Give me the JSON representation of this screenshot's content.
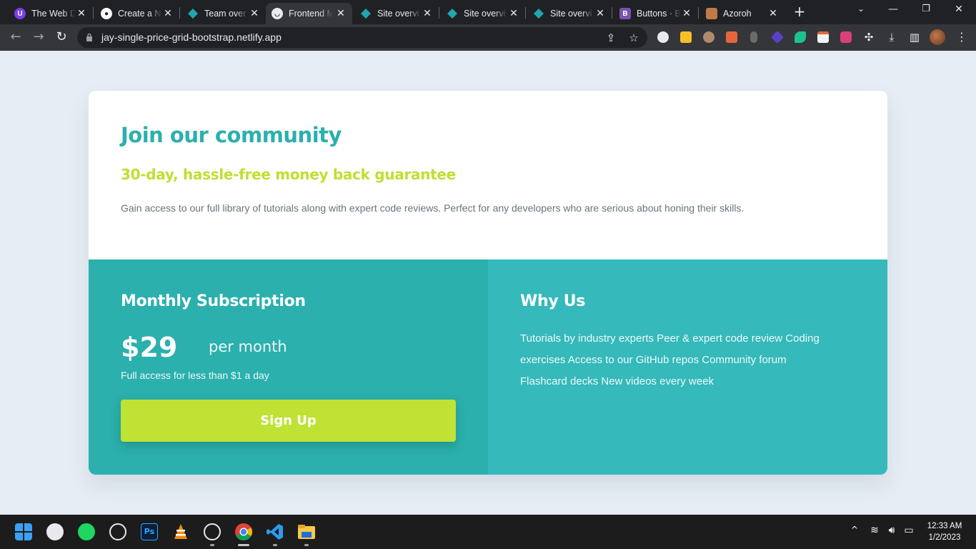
{
  "browser": {
    "tabs": [
      {
        "title": "The Web D",
        "favicon": "the-web-dev-icon",
        "color": "#7b3fe4"
      },
      {
        "title": "Create a N",
        "favicon": "github-icon",
        "color": "#ffffff"
      },
      {
        "title": "Team over",
        "favicon": "netlify-icon",
        "color": "#20a6b0"
      },
      {
        "title": "Frontend M",
        "favicon": "frontend-mentor-icon",
        "color": "#e8eaed"
      },
      {
        "title": "Site overvi",
        "favicon": "netlify-icon",
        "color": "#20a6b0"
      },
      {
        "title": "Site overvi",
        "favicon": "netlify-icon",
        "color": "#20a6b0"
      },
      {
        "title": "Site overvi",
        "favicon": "netlify-icon",
        "color": "#20a6b0"
      },
      {
        "title": "Buttons · B",
        "favicon": "bootstrap-icon",
        "color": "#7952b3"
      },
      {
        "title": "Azoroh",
        "favicon": "azoroh-avatar-icon",
        "color": "#c07a4a"
      }
    ],
    "url": "jay-single-price-grid-bootstrap.netlify.app"
  },
  "card": {
    "title": "Join our community",
    "guarantee": "30-day, hassle-free money back guarantee",
    "description": "Gain access to our full library of tutorials along with expert code reviews. Perfect for any developers who are serious about honing their skills.",
    "subscription": {
      "heading": "Monthly Subscription",
      "price": "$29",
      "period": "per month",
      "note": "Full access for less than $1 a day",
      "button": "Sign Up"
    },
    "why": {
      "heading": "Why Us",
      "text": "Tutorials by industry experts Peer & expert code review Coding exercises Access to our GitHub repos Community forum Flashcard decks New videos every week"
    }
  },
  "colors": {
    "cyan": "#2bb0ad",
    "light_cyan": "#35b9bb",
    "lime": "#bfe234",
    "background": "#e7edf4"
  },
  "taskbar": {
    "time": "12:33 AM",
    "date": "1/2/2023"
  }
}
